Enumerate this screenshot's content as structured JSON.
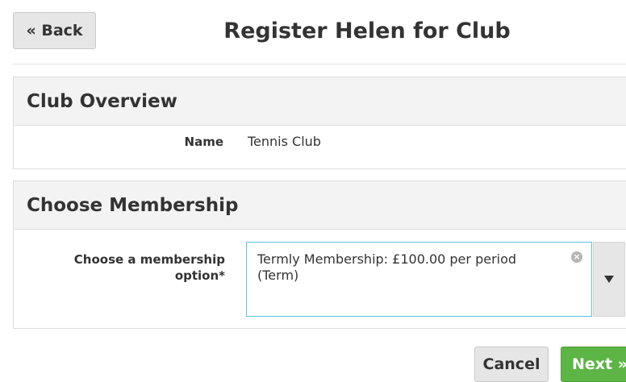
{
  "header": {
    "back_label": "« Back",
    "title": "Register Helen for Club"
  },
  "overview": {
    "heading": "Club Overview",
    "name_label": "Name",
    "name_value": "Tennis Club"
  },
  "membership": {
    "heading": "Choose Membership",
    "field_label": "Choose a membership option*",
    "selected_option": "Termly Membership: £100.00 per period (Term)"
  },
  "actions": {
    "cancel_label": "Cancel",
    "next_label": "Next »"
  },
  "colors": {
    "primary": "#5cb544",
    "focus_border": "#58c6dc",
    "panel_heading_bg": "#f3f3f3"
  },
  "icons": {
    "clear": "clear-icon",
    "dropdown": "chevron-down-icon"
  }
}
